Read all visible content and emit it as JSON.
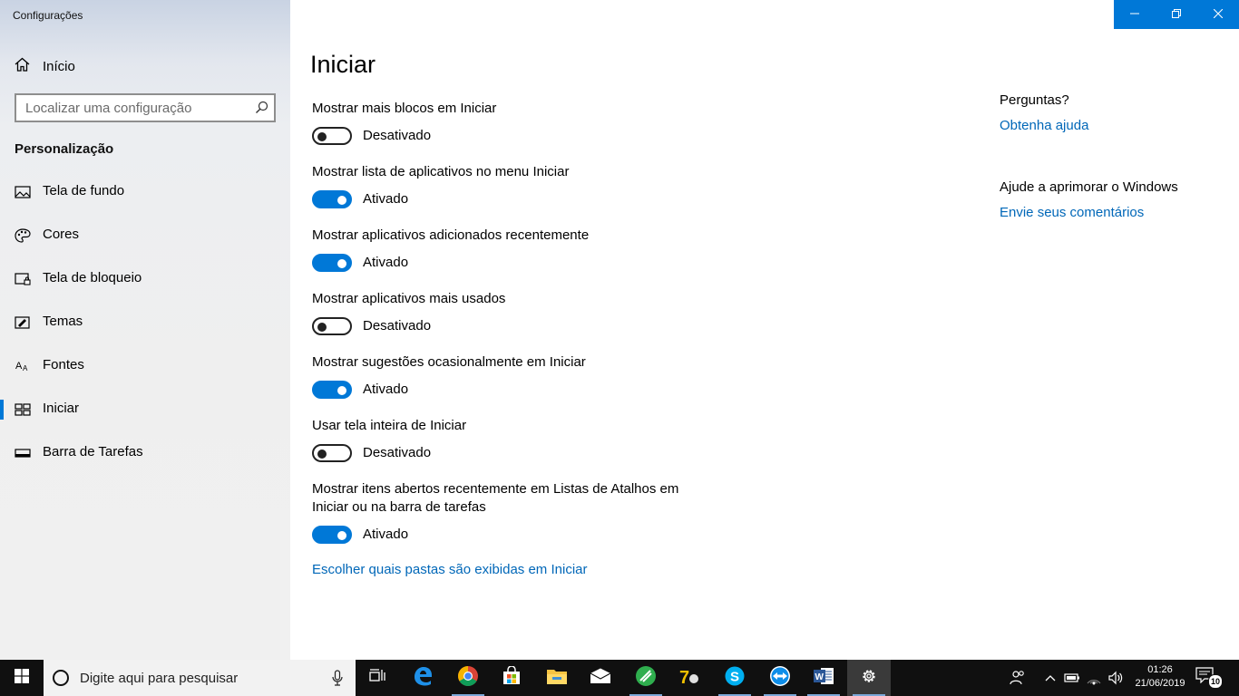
{
  "window": {
    "title": "Configurações"
  },
  "sidebar": {
    "home_label": "Início",
    "search_placeholder": "Localizar uma configuração",
    "section_title": "Personalização",
    "items": [
      {
        "label": "Tela de fundo",
        "icon": "picture-icon",
        "active": false
      },
      {
        "label": "Cores",
        "icon": "palette-icon",
        "active": false
      },
      {
        "label": "Tela de bloqueio",
        "icon": "lock-screen-icon",
        "active": false
      },
      {
        "label": "Temas",
        "icon": "brush-icon",
        "active": false
      },
      {
        "label": "Fontes",
        "icon": "font-icon",
        "active": false
      },
      {
        "label": "Iniciar",
        "icon": "start-tiles-icon",
        "active": true
      },
      {
        "label": "Barra de Tarefas",
        "icon": "taskbar-icon",
        "active": false
      }
    ]
  },
  "main": {
    "title": "Iniciar",
    "settings": [
      {
        "label": "Mostrar mais blocos em Iniciar",
        "state": "Desativado",
        "on": false
      },
      {
        "label": "Mostrar lista de aplicativos no menu Iniciar",
        "state": "Ativado",
        "on": true
      },
      {
        "label": "Mostrar aplicativos adicionados recentemente",
        "state": "Ativado",
        "on": true
      },
      {
        "label": "Mostrar aplicativos mais usados",
        "state": "Desativado",
        "on": false
      },
      {
        "label": "Mostrar sugestões ocasionalmente em Iniciar",
        "state": "Ativado",
        "on": true
      },
      {
        "label": "Usar tela inteira de Iniciar",
        "state": "Desativado",
        "on": false
      },
      {
        "label": "Mostrar itens abertos recentemente em Listas de Atalhos em Iniciar ou na barra de tarefas",
        "state": "Ativado",
        "on": true
      }
    ],
    "folders_link": "Escolher quais pastas são exibidas em Iniciar"
  },
  "aside": {
    "questions_title": "Perguntas?",
    "help_link": "Obtenha ajuda",
    "improve_title": "Ajude a aprimorar o Windows",
    "feedback_link": "Envie seus comentários"
  },
  "taskbar": {
    "search_placeholder": "Digite aqui para pesquisar",
    "time": "01:26",
    "date": "21/06/2019",
    "notification_count": "10",
    "apps": [
      "task-view-icon",
      "edge-icon",
      "chrome-icon",
      "store-icon",
      "file-explorer-icon",
      "mail-icon",
      "green-app-icon",
      "7zip-icon",
      "skype-icon",
      "teamviewer-icon",
      "word-icon",
      "settings-icon"
    ]
  },
  "colors": {
    "accent": "#0078d7",
    "link": "#0067b8"
  }
}
